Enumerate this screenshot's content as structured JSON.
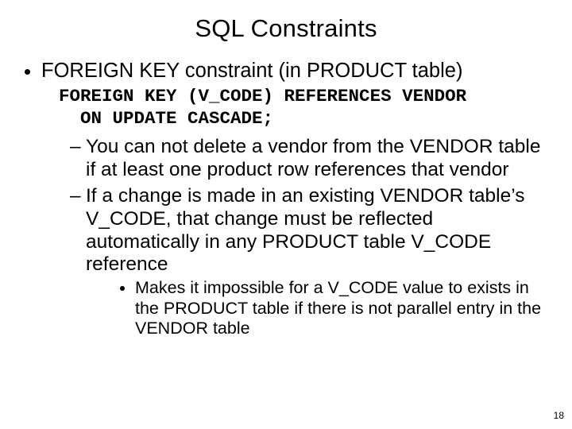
{
  "title": "SQL Constraints",
  "bullet1": "FOREIGN KEY constraint (in PRODUCT  table)",
  "code_line1": "FOREIGN KEY (V_CODE) REFERENCES VENDOR",
  "code_line2": "  ON UPDATE CASCADE;",
  "sub1": "You can not delete a vendor from the VENDOR table if at least one product row references that vendor",
  "sub2": "If a change is made in an existing VENDOR table’s V_CODE, that change must be reflected automatically in any PRODUCT table V_CODE reference",
  "subsub": "Makes it impossible for a V_CODE value to exists in the PRODUCT table if there is not parallel entry in the VENDOR table",
  "page_number": "18"
}
